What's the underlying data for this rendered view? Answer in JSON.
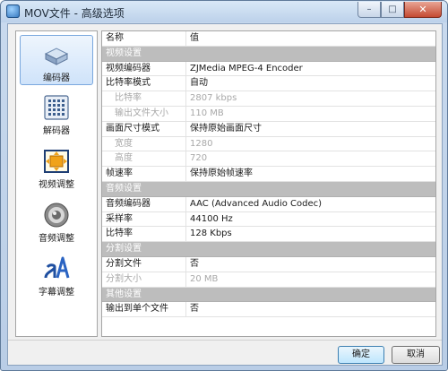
{
  "window": {
    "title": "MOV文件 - 高级选项",
    "minimize_symbol": "–",
    "maximize_symbol": "□",
    "close_symbol": "✕"
  },
  "sidebar": {
    "items": [
      {
        "label": "编码器",
        "icon": "encoder-icon",
        "active": true
      },
      {
        "label": "解码器",
        "icon": "decoder-icon",
        "active": false
      },
      {
        "label": "视频调整",
        "icon": "video-adjust-icon",
        "active": false
      },
      {
        "label": "音频调整",
        "icon": "audio-adjust-icon",
        "active": false
      },
      {
        "label": "字幕调整",
        "icon": "subtitle-adjust-icon",
        "active": false
      }
    ]
  },
  "grid": {
    "header": {
      "name": "名称",
      "value": "值"
    },
    "rows": [
      {
        "type": "section",
        "name": "视频设置",
        "value": ""
      },
      {
        "type": "item",
        "name": "视频编码器",
        "value": "ZJMedia MPEG-4 Encoder"
      },
      {
        "type": "item",
        "name": "比特率模式",
        "value": "自动"
      },
      {
        "type": "sub-disabled",
        "name": "比特率",
        "value": "2807 kbps"
      },
      {
        "type": "sub-disabled",
        "name": "输出文件大小",
        "value": "110 MB"
      },
      {
        "type": "item",
        "name": "画面尺寸模式",
        "value": "保持原始画面尺寸"
      },
      {
        "type": "sub-disabled",
        "name": "宽度",
        "value": "1280"
      },
      {
        "type": "sub-disabled",
        "name": "高度",
        "value": "720"
      },
      {
        "type": "item",
        "name": "帧速率",
        "value": "保持原始帧速率"
      },
      {
        "type": "section",
        "name": "音频设置",
        "value": ""
      },
      {
        "type": "item",
        "name": "音频编码器",
        "value": "AAC (Advanced Audio Codec)"
      },
      {
        "type": "item",
        "name": "采样率",
        "value": "44100 Hz"
      },
      {
        "type": "item",
        "name": "比特率",
        "value": "128 Kbps"
      },
      {
        "type": "section",
        "name": "分割设置",
        "value": ""
      },
      {
        "type": "item",
        "name": "分割文件",
        "value": "否"
      },
      {
        "type": "disabled",
        "name": "分割大小",
        "value": "20 MB"
      },
      {
        "type": "section",
        "name": "其他设置",
        "value": ""
      },
      {
        "type": "item",
        "name": "输出到单个文件",
        "value": "否"
      }
    ]
  },
  "buttons": {
    "ok": "确定",
    "cancel": "取消"
  },
  "colors": {
    "section_bg": "#bdbdbd",
    "active_item_bg": "#cfe3fa",
    "disabled_text": "#a8a8a8"
  }
}
